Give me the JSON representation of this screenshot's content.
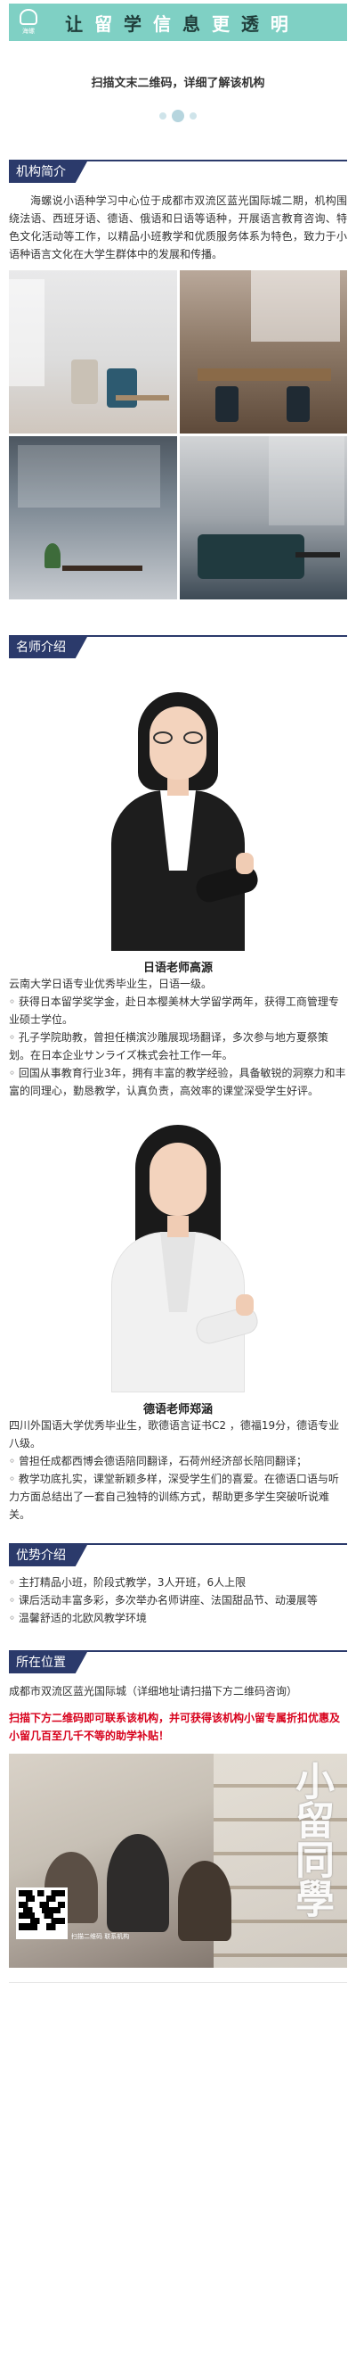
{
  "banner": {
    "brand": "海螺",
    "title_parts": [
      "让",
      "留",
      "学",
      "信",
      "息",
      "更",
      "透",
      "明"
    ]
  },
  "scan_tip": "扫描文末二维码，详细了解该机构",
  "sections": {
    "intro": "机构简介",
    "teachers": "名师介绍",
    "advantages": "优势介绍",
    "location": "所在位置"
  },
  "intro_text": "海螺说小语种学习中心位于成都市双流区蓝光国际城二期，机构围绕法语、西班牙语、德语、俄语和日语等语种，开展语言教育咨询、特色文化活动等工作，以精品小班教学和优质服务体系为特色，致力于小语种语言文化在大学生群体中的发展和传播。",
  "teachers": [
    {
      "name": "日语老师高源",
      "lines": [
        "云南大学日语专业优秀毕业生，日语一级。",
        "◦ 获得日本留学奖学金，赴日本樱美林大学留学两年，获得工商管理专业硕士学位。",
        "◦ 孔子学院助教，曾担任横滨沙雕展现场翻译，多次参与地方夏祭策划。在日本企业サンライズ株式会社工作一年。",
        "◦ 回国从事教育行业3年，拥有丰富的教学经验，具备敏锐的洞察力和丰富的同理心，勤恳教学，认真负责，高效率的课堂深受学生好评。"
      ]
    },
    {
      "name": "德语老师郑涵",
      "lines": [
        "四川外国语大学优秀毕业生，歌德语言证书C2 ，德福19分，德语专业八级。",
        "◦ 曾担任成都西博会德语陪同翻译，石荷州经济部长陪同翻译；",
        "◦ 教学功底扎实，课堂新颖多样，深受学生们的喜爱。在德语口语与听力方面总结出了一套自己独特的训练方式，帮助更多学生突破听说难关。"
      ]
    }
  ],
  "advantages": [
    "◦ 主打精品小班，阶段式教学，3人开班，6人上限",
    "◦ 课后活动丰富多彩，多次举办名师讲座、法国甜品节、动漫展等",
    "◦ 温馨舒适的北欧风教学环境"
  ],
  "location_text": "成都市双流区蓝光国际城（详细地址请扫描下方二维码咨询）",
  "highlight": "扫描下方二维码即可联系该机构，并可获得该机构小留专属折扣优惠及小留几百至几千不等的助学补贴！",
  "bottom": {
    "calligraphy": "小留同學",
    "qr_caption": "扫描二维码 联系机构"
  },
  "colors": {
    "banner": "#7fd0c4",
    "section": "#2b3a6b",
    "highlight": "#d7001b"
  }
}
